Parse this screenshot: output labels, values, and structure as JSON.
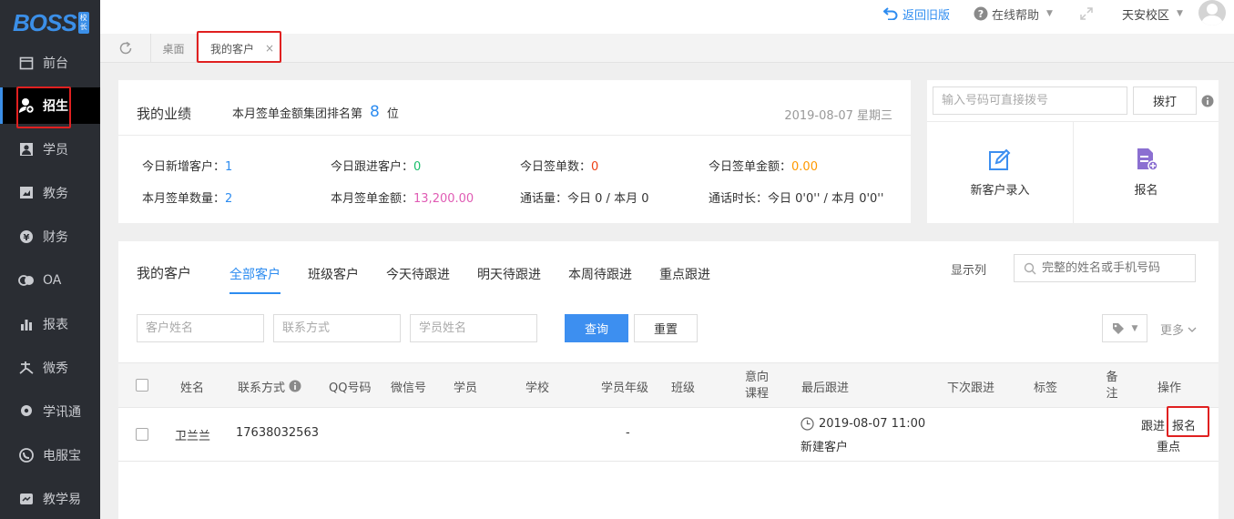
{
  "brand": {
    "logo_text": "BOSS",
    "logo_tag": "校长"
  },
  "sidebar": {
    "items": [
      {
        "label": "前台",
        "icon": "calendar-icon"
      },
      {
        "label": "招生",
        "icon": "add-user-icon"
      },
      {
        "label": "学员",
        "icon": "student-icon"
      },
      {
        "label": "教务",
        "icon": "book-icon"
      },
      {
        "label": "财务",
        "icon": "yen-icon"
      },
      {
        "label": "OA",
        "icon": "oa-icon"
      },
      {
        "label": "报表",
        "icon": "bar-chart-icon"
      },
      {
        "label": "微秀",
        "icon": "xiu-icon"
      },
      {
        "label": "学讯通",
        "icon": "location-icon"
      },
      {
        "label": "电服宝",
        "icon": "phone-icon"
      },
      {
        "label": "教学易",
        "icon": "teach-icon"
      }
    ],
    "active_index": 1
  },
  "header": {
    "back_old": "返回旧版",
    "help": "在线帮助",
    "campus": "天安校区"
  },
  "tabs": {
    "items": [
      {
        "label": "桌面"
      },
      {
        "label": "我的客户"
      }
    ],
    "close_glyph": "×"
  },
  "performance": {
    "title": "我的业绩",
    "rank_prefix": "本月签单金额集团排名第",
    "rank_value": "8",
    "rank_suffix": "位",
    "date": "2019-08-07 星期三",
    "stats": [
      {
        "label": "今日新增客户：",
        "value": "1",
        "color": "#2d8cf0"
      },
      {
        "label": "今日跟进客户：",
        "value": "0",
        "color": "#19be6b"
      },
      {
        "label": "今日签单数：",
        "value": "0",
        "color": "#ed4014"
      },
      {
        "label": "今日签单金额：",
        "value": "0.00",
        "color": "#ff9900"
      },
      {
        "label": "本月签单数量：",
        "value": "2",
        "color": "#2d8cf0"
      },
      {
        "label": "本月签单金额：",
        "value": "13,200.00",
        "color": "#e05cb4"
      },
      {
        "label": "通话量：",
        "value": "今日 0 / 本月 0",
        "color": "#333333"
      },
      {
        "label": "通话时长：",
        "value": "今日 0'0'' / 本月 0'0''",
        "color": "#333333"
      }
    ]
  },
  "dial": {
    "placeholder": "输入号码可直接拨号",
    "dial_button": "拨打",
    "new_customer": "新客户录入",
    "enroll": "报名"
  },
  "customers": {
    "title": "我的客户",
    "tabs": [
      "全部客户",
      "班级客户",
      "今天待跟进",
      "明天待跟进",
      "本周待跟进",
      "重点跟进"
    ],
    "active_tab": 0,
    "show_columns": "显示列",
    "search_placeholder": "完整的姓名或手机号码",
    "filters": {
      "name_placeholder": "客户姓名",
      "contact_placeholder": "联系方式",
      "student_placeholder": "学员姓名",
      "query": "查询",
      "reset": "重置",
      "more": "更多"
    },
    "columns": [
      "姓名",
      "联系方式",
      "QQ号码",
      "微信号",
      "学员",
      "学校",
      "学员年级",
      "班级",
      "意向课程",
      "最后跟进",
      "下次跟进",
      "标签",
      "备注",
      "操作"
    ],
    "rows": [
      {
        "name": "卫兰兰",
        "phone": "17638032563",
        "grade": "-",
        "last_follow_time": "2019-08-07 11:00",
        "last_follow_note": "新建客户",
        "actions": {
          "follow": "跟进",
          "enroll": "报名",
          "key": "重点"
        }
      }
    ]
  }
}
